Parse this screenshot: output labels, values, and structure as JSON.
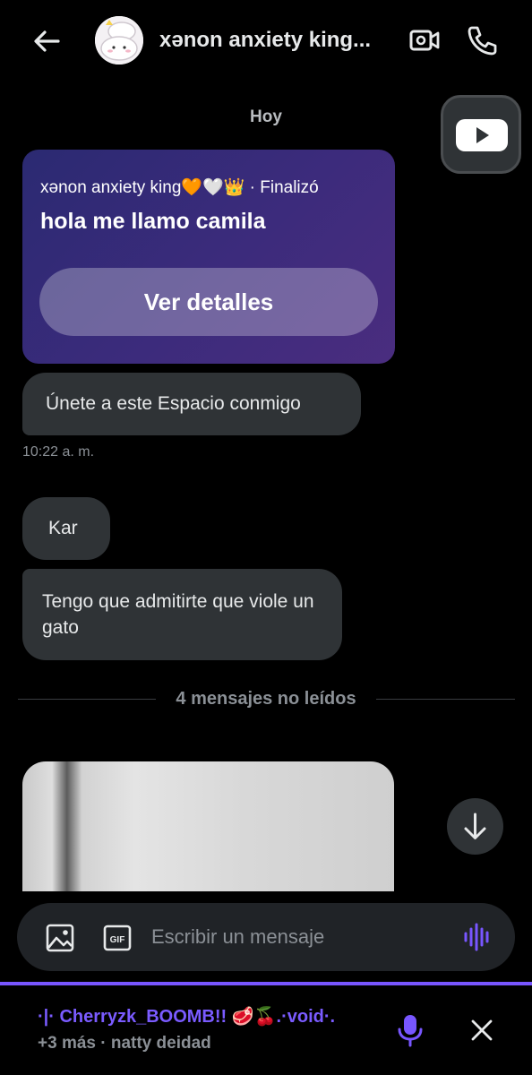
{
  "header": {
    "title": "xənon anxiety king...",
    "back_icon": "arrow-left-icon",
    "video_icon": "video-camera-icon",
    "call_icon": "phone-icon"
  },
  "conversation": {
    "day_label": "Hoy",
    "space_card": {
      "host_line": "xənon anxiety king🧡🤍👑 · Finalizó",
      "title": "hola me llamo camila",
      "button_label": "Ver detalles"
    },
    "messages": [
      {
        "text": "Únete a este Espacio conmigo"
      },
      {
        "text": "Kar"
      },
      {
        "text": "Tengo que admitirte que viole un gato"
      }
    ],
    "time_label": "10:22 a. m.",
    "unread_divider": "4 mensajes no leídos"
  },
  "composer": {
    "placeholder": "Escribir un mensaje",
    "value": ""
  },
  "space_bar": {
    "title": "·|· Cherryzk_BOOMB!! 🥩🍒.·void·.",
    "subtitle": "+3 más · natty deidad"
  },
  "colors": {
    "background": "#000000",
    "bubble": "#2f3336",
    "accent": "#7856ff",
    "card_gradient_start": "#2b2a72",
    "card_gradient_end": "#4a2d7f"
  }
}
